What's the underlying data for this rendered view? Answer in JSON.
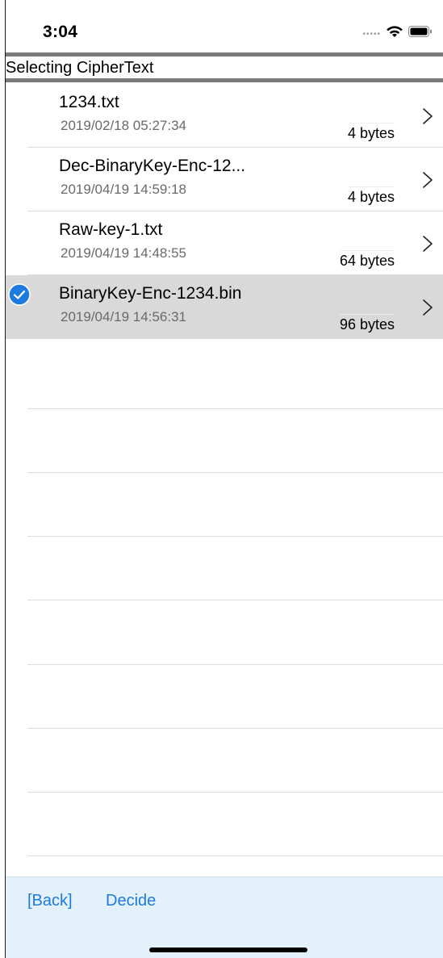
{
  "status_bar": {
    "time": "3:04",
    "signal_icon": "signal-dots-icon",
    "wifi_icon": "wifi-icon",
    "battery_icon": "battery-icon"
  },
  "header": {
    "title": "Selecting CipherText"
  },
  "files": [
    {
      "name": "1234.txt",
      "date": "2019/02/18  05:27:34",
      "size": "4 bytes",
      "selected": false
    },
    {
      "name": "Dec-BinaryKey-Enc-12...",
      "date": "2019/04/19  14:59:18",
      "size": "4 bytes",
      "selected": false
    },
    {
      "name": "Raw-key-1.txt",
      "date": "2019/04/19  14:48:55",
      "size": "64 bytes",
      "selected": false
    },
    {
      "name": "BinaryKey-Enc-1234.bin",
      "date": "2019/04/19  14:56:31",
      "size": "96 bytes",
      "selected": true
    }
  ],
  "toolbar": {
    "back_label": "[Back]",
    "decide_label": "Decide"
  },
  "colors": {
    "accent": "#1f7ae0",
    "selected_row": "#d9d9d9",
    "toolbar_bg": "#e3f1fa",
    "header_bar": "#7a7a7a"
  }
}
